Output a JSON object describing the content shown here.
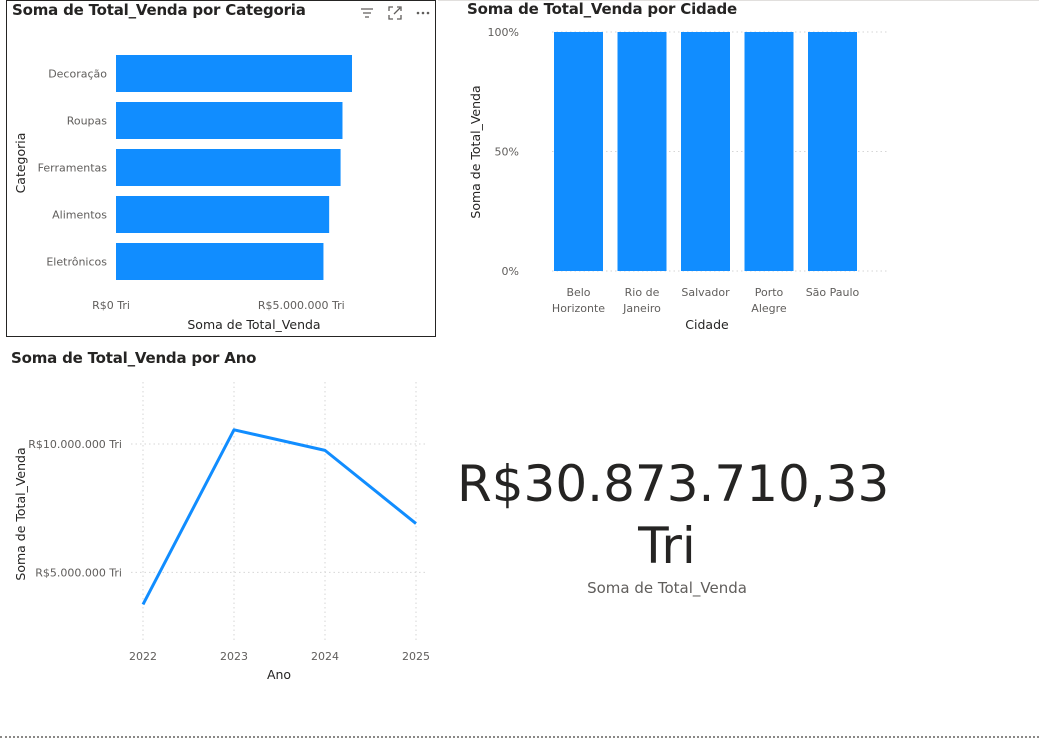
{
  "colors": {
    "series": "#118DFF",
    "grid": "#d6d6d6",
    "text": "#605e5c",
    "title": "#252423"
  },
  "header_icons": [
    "filter-icon",
    "focus-mode-icon",
    "more-options-icon"
  ],
  "chart_data": [
    {
      "type": "bar",
      "orientation": "horizontal",
      "title": "Soma de Total_Venda por Categoria",
      "xlabel": "Soma de Total_Venda",
      "ylabel": "Categoria",
      "categories": [
        "Decoração",
        "Roupas",
        "Ferramentas",
        "Alimentos",
        "Eletrônicos"
      ],
      "values": [
        6200000,
        5950000,
        5900000,
        5600000,
        5450000
      ],
      "xlim": [
        0,
        6500000
      ],
      "xticks": [
        {
          "value": 0,
          "label": "R$0 Tri"
        },
        {
          "value": 5000000,
          "label": "R$5.000.000 Tri"
        }
      ],
      "grid": false
    },
    {
      "type": "bar",
      "orientation": "vertical",
      "stacking": "100%",
      "title": "Soma de Total_Venda por Cidade",
      "xlabel": "Cidade",
      "ylabel": "Soma de Total_Venda",
      "categories": [
        [
          "Belo",
          "Horizonte"
        ],
        [
          "Rio de",
          "Janeiro"
        ],
        [
          "Salvador"
        ],
        [
          "Porto",
          "Alegre"
        ],
        [
          "São Paulo"
        ]
      ],
      "values": [
        100,
        100,
        100,
        100,
        100
      ],
      "ylim": [
        0,
        100
      ],
      "yticks": [
        {
          "value": 0,
          "label": "0%"
        },
        {
          "value": 50,
          "label": "50%"
        },
        {
          "value": 100,
          "label": "100%"
        }
      ],
      "grid": true
    },
    {
      "type": "line",
      "title": "Soma de Total_Venda por Ano",
      "xlabel": "Ano",
      "ylabel": "Soma de Total_Venda",
      "x": [
        "2022",
        "2023",
        "2024",
        "2025"
      ],
      "values": [
        3750000,
        10550000,
        9750000,
        6900000
      ],
      "ylim": [
        2600000,
        11750000
      ],
      "yticks": [
        {
          "value": 5000000,
          "label": "R$5.000.000 Tri"
        },
        {
          "value": 10000000,
          "label": "R$10.000.000 Tri"
        }
      ],
      "grid": true
    }
  ],
  "card": {
    "value_line1": "R$30.873.710,33",
    "value_line2": "Tri",
    "label": "Soma de Total_Venda"
  }
}
